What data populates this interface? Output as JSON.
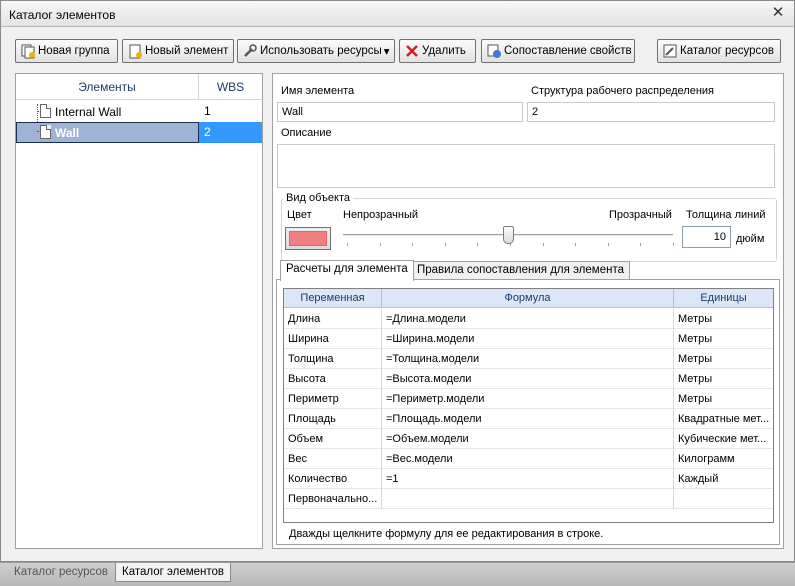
{
  "window": {
    "title": "Каталог элементов",
    "close_glyph": "✕"
  },
  "toolbar": {
    "new_group": "Новая группа",
    "new_element": "Новый элемент",
    "use_resources": "Использовать ресурсы",
    "use_resources_arrow": "▾",
    "delete": "Удалить",
    "property_mapping": "Сопоставление свойств",
    "resource_catalog": "Каталог ресурсов"
  },
  "tree": {
    "col_elements": "Элементы",
    "col_wbs": "WBS",
    "rows": [
      {
        "name": "Internal Wall",
        "wbs": "1"
      },
      {
        "name": "Wall",
        "wbs": "2"
      }
    ]
  },
  "details": {
    "name_label": "Имя элемента",
    "name_value": "Wall",
    "wbs_label": "Структура рабочего распределения",
    "wbs_value": "2",
    "description_label": "Описание",
    "description_value": "",
    "appearance_title": "Вид объекта",
    "color_label": "Цвет",
    "opaque_label": "Непрозрачный",
    "transparent_label": "Прозрачный",
    "line_thickness_label": "Толщина линий",
    "line_thickness_value": "10",
    "line_thickness_unit": "дюйм",
    "color": "#f08080",
    "transparency_fraction": 0.5
  },
  "tabs": [
    {
      "label": "Расчеты для элемента",
      "active": true
    },
    {
      "label": "Правила сопоставления для элемента",
      "active": false
    }
  ],
  "grid": {
    "col_variable": "Переменная",
    "col_formula": "Формула",
    "col_units": "Единицы",
    "rows": [
      {
        "variable": "Длина",
        "formula": "=Длина.модели",
        "units": "Метры"
      },
      {
        "variable": "Ширина",
        "formula": "=Ширина.модели",
        "units": "Метры"
      },
      {
        "variable": "Толщина",
        "formula": "=Толщина.модели",
        "units": "Метры"
      },
      {
        "variable": "Высота",
        "formula": "=Высота.модели",
        "units": "Метры"
      },
      {
        "variable": "Периметр",
        "formula": "=Периметр.модели",
        "units": "Метры"
      },
      {
        "variable": "Площадь",
        "formula": "=Площадь.модели",
        "units": "Квадратные мет..."
      },
      {
        "variable": "Объем",
        "formula": "=Объем.модели",
        "units": "Кубические мет..."
      },
      {
        "variable": "Вес",
        "formula": "=Вес.модели",
        "units": "Килограмм"
      },
      {
        "variable": "Количество",
        "formula": "=1",
        "units": "Каждый"
      },
      {
        "variable": "Первоначально...",
        "formula": "",
        "units": ""
      }
    ]
  },
  "hint": "Дважды щелкните формулу для ее редактирования в строке.",
  "bottom_tabs": [
    {
      "label": "Каталог ресурсов",
      "active": false
    },
    {
      "label": "Каталог элементов",
      "active": true
    }
  ]
}
